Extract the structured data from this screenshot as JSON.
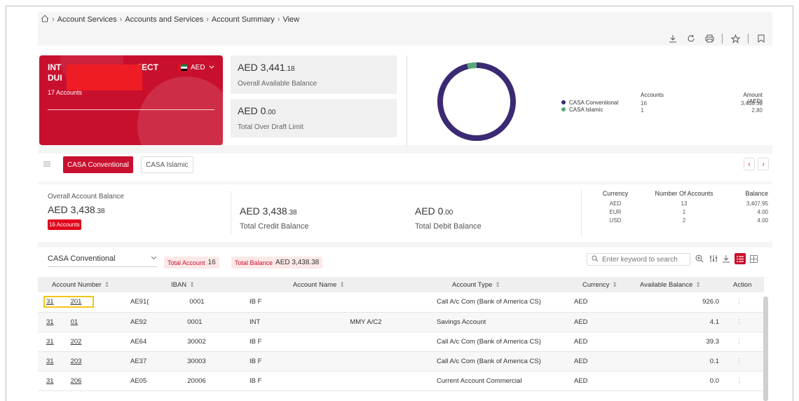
{
  "breadcrumb": [
    "Account Services",
    "Accounts and Services",
    "Account Summary",
    "View"
  ],
  "toolbar": {
    "icons": [
      "download-icon",
      "refresh-icon",
      "print-icon",
      "star-icon",
      "bookmark-icon"
    ]
  },
  "company_card": {
    "name_visible_start": "INT",
    "name_visible_mid": "JECT",
    "name_line2": "DUI",
    "accounts_label": "17 Accounts",
    "currency": "AED",
    "card_color": "#c8102e"
  },
  "balances": {
    "overall_available": {
      "amount": "AED 3,441",
      "decimals": ".18",
      "label": "Overall Available Balance"
    },
    "overdraft": {
      "amount": "AED 0",
      "decimals": ".00",
      "label": "Total Over Draft Limit"
    }
  },
  "donut": {
    "legend": [
      {
        "name": "CASA Conventional",
        "color": "#3b2a73",
        "accounts": "16",
        "amount": "3,438.38"
      },
      {
        "name": "CASA Islamic",
        "color": "#5aa978",
        "accounts": "1",
        "amount": "2.80"
      }
    ],
    "headers": {
      "accounts": "Accounts",
      "amount": "Amount (AED)"
    },
    "islamic_fraction": 0.04
  },
  "tabs": {
    "active": "CASA Conventional",
    "inactive": "CASA Islamic"
  },
  "summary": {
    "overall_label": "Overall Account Balance",
    "overall_amount": "AED 3,438",
    "overall_decimals": ".38",
    "badge": "16 Accounts",
    "credit_amount": "AED 3,438",
    "credit_decimals": ".38",
    "credit_label": "Total Credit Balance",
    "debit_amount": "AED 0",
    "debit_decimals": ".00",
    "debit_label": "Total Debit Balance",
    "currency_table": {
      "headers": [
        "Currency",
        "Number Of Accounts",
        "Balance"
      ],
      "rows": [
        [
          "AED",
          "13",
          "3,407.95"
        ],
        [
          "EUR",
          "1",
          "4.00"
        ],
        [
          "USD",
          "2",
          "4.00"
        ]
      ]
    }
  },
  "filter": {
    "select_value": "CASA Conventional",
    "total_account_label": "Total Account",
    "total_account_value": "16",
    "total_balance_label": "Total Balance",
    "total_balance_value": "AED 3,438.38",
    "search_placeholder": "Enter keyword to search"
  },
  "grid": {
    "headers": [
      "Account Number",
      "IBAN",
      "Account Name",
      "Account Type",
      "Currency",
      "Available Balance",
      "Action"
    ],
    "rows": [
      {
        "acc_a": "31",
        "acc_b": "201",
        "iban_a": "AE91(",
        "iban_b": "0001",
        "name_a": "IB F",
        "name_b": "",
        "type": "Call A/c Com (Bank of America CS)",
        "currency": "AED",
        "balance": "926.0"
      },
      {
        "acc_a": "31",
        "acc_b": "01",
        "iban_a": "AE92",
        "iban_b": "0001",
        "name_a": "INT",
        "name_b": "MMY A/C2",
        "type": "Savings Account",
        "currency": "AED",
        "balance": "4.1"
      },
      {
        "acc_a": "31",
        "acc_b": "202",
        "iban_a": "AE64",
        "iban_b": "30002",
        "name_a": "IB F",
        "name_b": "",
        "type": "Call A/c Com (Bank of America CS)",
        "currency": "AED",
        "balance": "39.3"
      },
      {
        "acc_a": "31",
        "acc_b": "203",
        "iban_a": "AE37",
        "iban_b": "30003",
        "name_a": "IB F",
        "name_b": "",
        "type": "Call A/c Com (Bank of America CS)",
        "currency": "AED",
        "balance": "0.1"
      },
      {
        "acc_a": "31",
        "acc_b": "206",
        "iban_a": "AE05",
        "iban_b": "20006",
        "name_a": "IB F",
        "name_b": "",
        "type": "Current Account Commercial",
        "currency": "AED",
        "balance": "0.0"
      }
    ],
    "action_glyph": "⋮"
  }
}
